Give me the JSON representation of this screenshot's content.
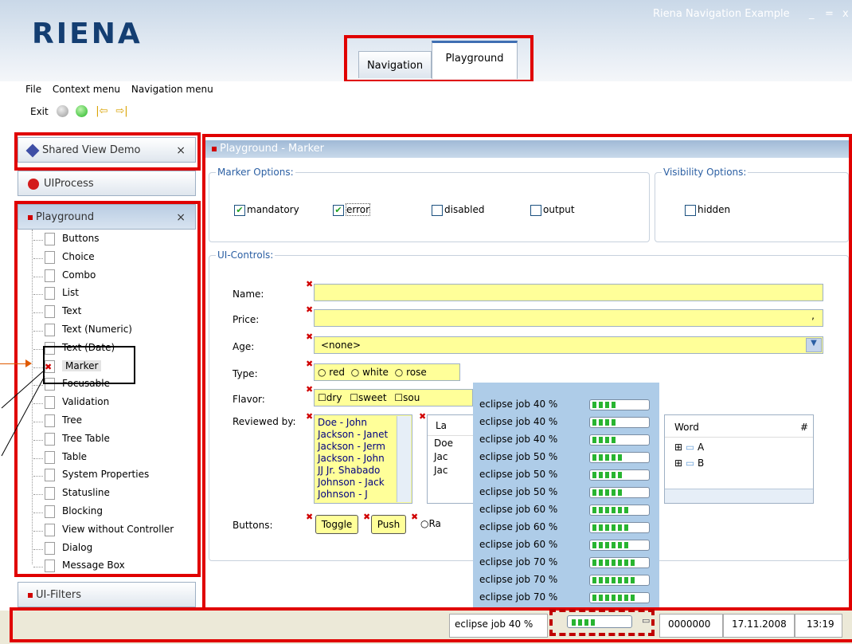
{
  "app": {
    "logo": "RIENA",
    "title": "Riena Navigation Example",
    "win_min": "_",
    "win_max": "=",
    "win_close": "x"
  },
  "tabs": [
    {
      "label": "Navigation"
    },
    {
      "label": "Playground"
    }
  ],
  "menubar": {
    "file": "File",
    "context": "Context menu",
    "navigation": "Navigation menu"
  },
  "toolbar": {
    "exit": "Exit"
  },
  "nav": {
    "shared": "Shared View Demo",
    "uiprocess": "UIProcess",
    "playground": "Playground",
    "uifilters": "UI-Filters",
    "close": "×",
    "items": [
      "Buttons",
      "Choice",
      "Combo",
      "List",
      "Text",
      "Text (Numeric)",
      "Text (Date)",
      "Marker",
      "Focusable",
      "Validation",
      "Tree",
      "Tree Table",
      "Table",
      "System Properties",
      "Statusline",
      "Blocking",
      "View without Controller",
      "Dialog",
      "Message Box"
    ]
  },
  "main": {
    "title": "Playground - Marker",
    "marker_options": {
      "label": "Marker Options:",
      "mandatory": "mandatory",
      "error": "error",
      "disabled": "disabled",
      "output": "output"
    },
    "visibility": {
      "label": "Visibility Options:",
      "hidden": "hidden"
    },
    "controls": {
      "label": "UI-Controls:",
      "name": "Name:",
      "price": "Price:",
      "price_value": ",",
      "age": "Age:",
      "age_value": "<none>",
      "type": "Type:",
      "type_options": [
        "red",
        "white",
        "rose"
      ],
      "flavor": "Flavor:",
      "flavor_options": [
        "dry",
        "sweet",
        "sou"
      ],
      "reviewed": "Reviewed by:",
      "reviewers": [
        "Doe - John",
        "Jackson - Janet",
        "Jackson - Jerm",
        "Jackson - John",
        "JJ Jr. Shabado",
        "Johnson - Jack",
        "Johnson - J"
      ],
      "table_header": "La",
      "table_rows": [
        "Doe",
        "Jac",
        "Jac"
      ],
      "tree_header": "Word",
      "tree_header2": "#",
      "tree_nodes": [
        "A",
        "B"
      ],
      "buttons": "Buttons:",
      "toggle": "Toggle",
      "push": "Push",
      "radio": "Ra"
    }
  },
  "jobs": [
    {
      "label": "eclipse job 40 %",
      "value": 40
    },
    {
      "label": "eclipse job 40 %",
      "value": 40
    },
    {
      "label": "eclipse job 40 %",
      "value": 40
    },
    {
      "label": "eclipse job 50 %",
      "value": 50
    },
    {
      "label": "eclipse job 50 %",
      "value": 50
    },
    {
      "label": "eclipse job 50 %",
      "value": 50
    },
    {
      "label": "eclipse job 60 %",
      "value": 60
    },
    {
      "label": "eclipse job 60 %",
      "value": 60
    },
    {
      "label": "eclipse job 60 %",
      "value": 60
    },
    {
      "label": "eclipse job 70 %",
      "value": 70
    },
    {
      "label": "eclipse job 70 %",
      "value": 70
    },
    {
      "label": "eclipse job 70 %",
      "value": 70
    }
  ],
  "statusbar": {
    "job": "eclipse job 40 %",
    "job_value": 40,
    "number": "0000000",
    "date": "17.11.2008",
    "time": "13:19"
  }
}
